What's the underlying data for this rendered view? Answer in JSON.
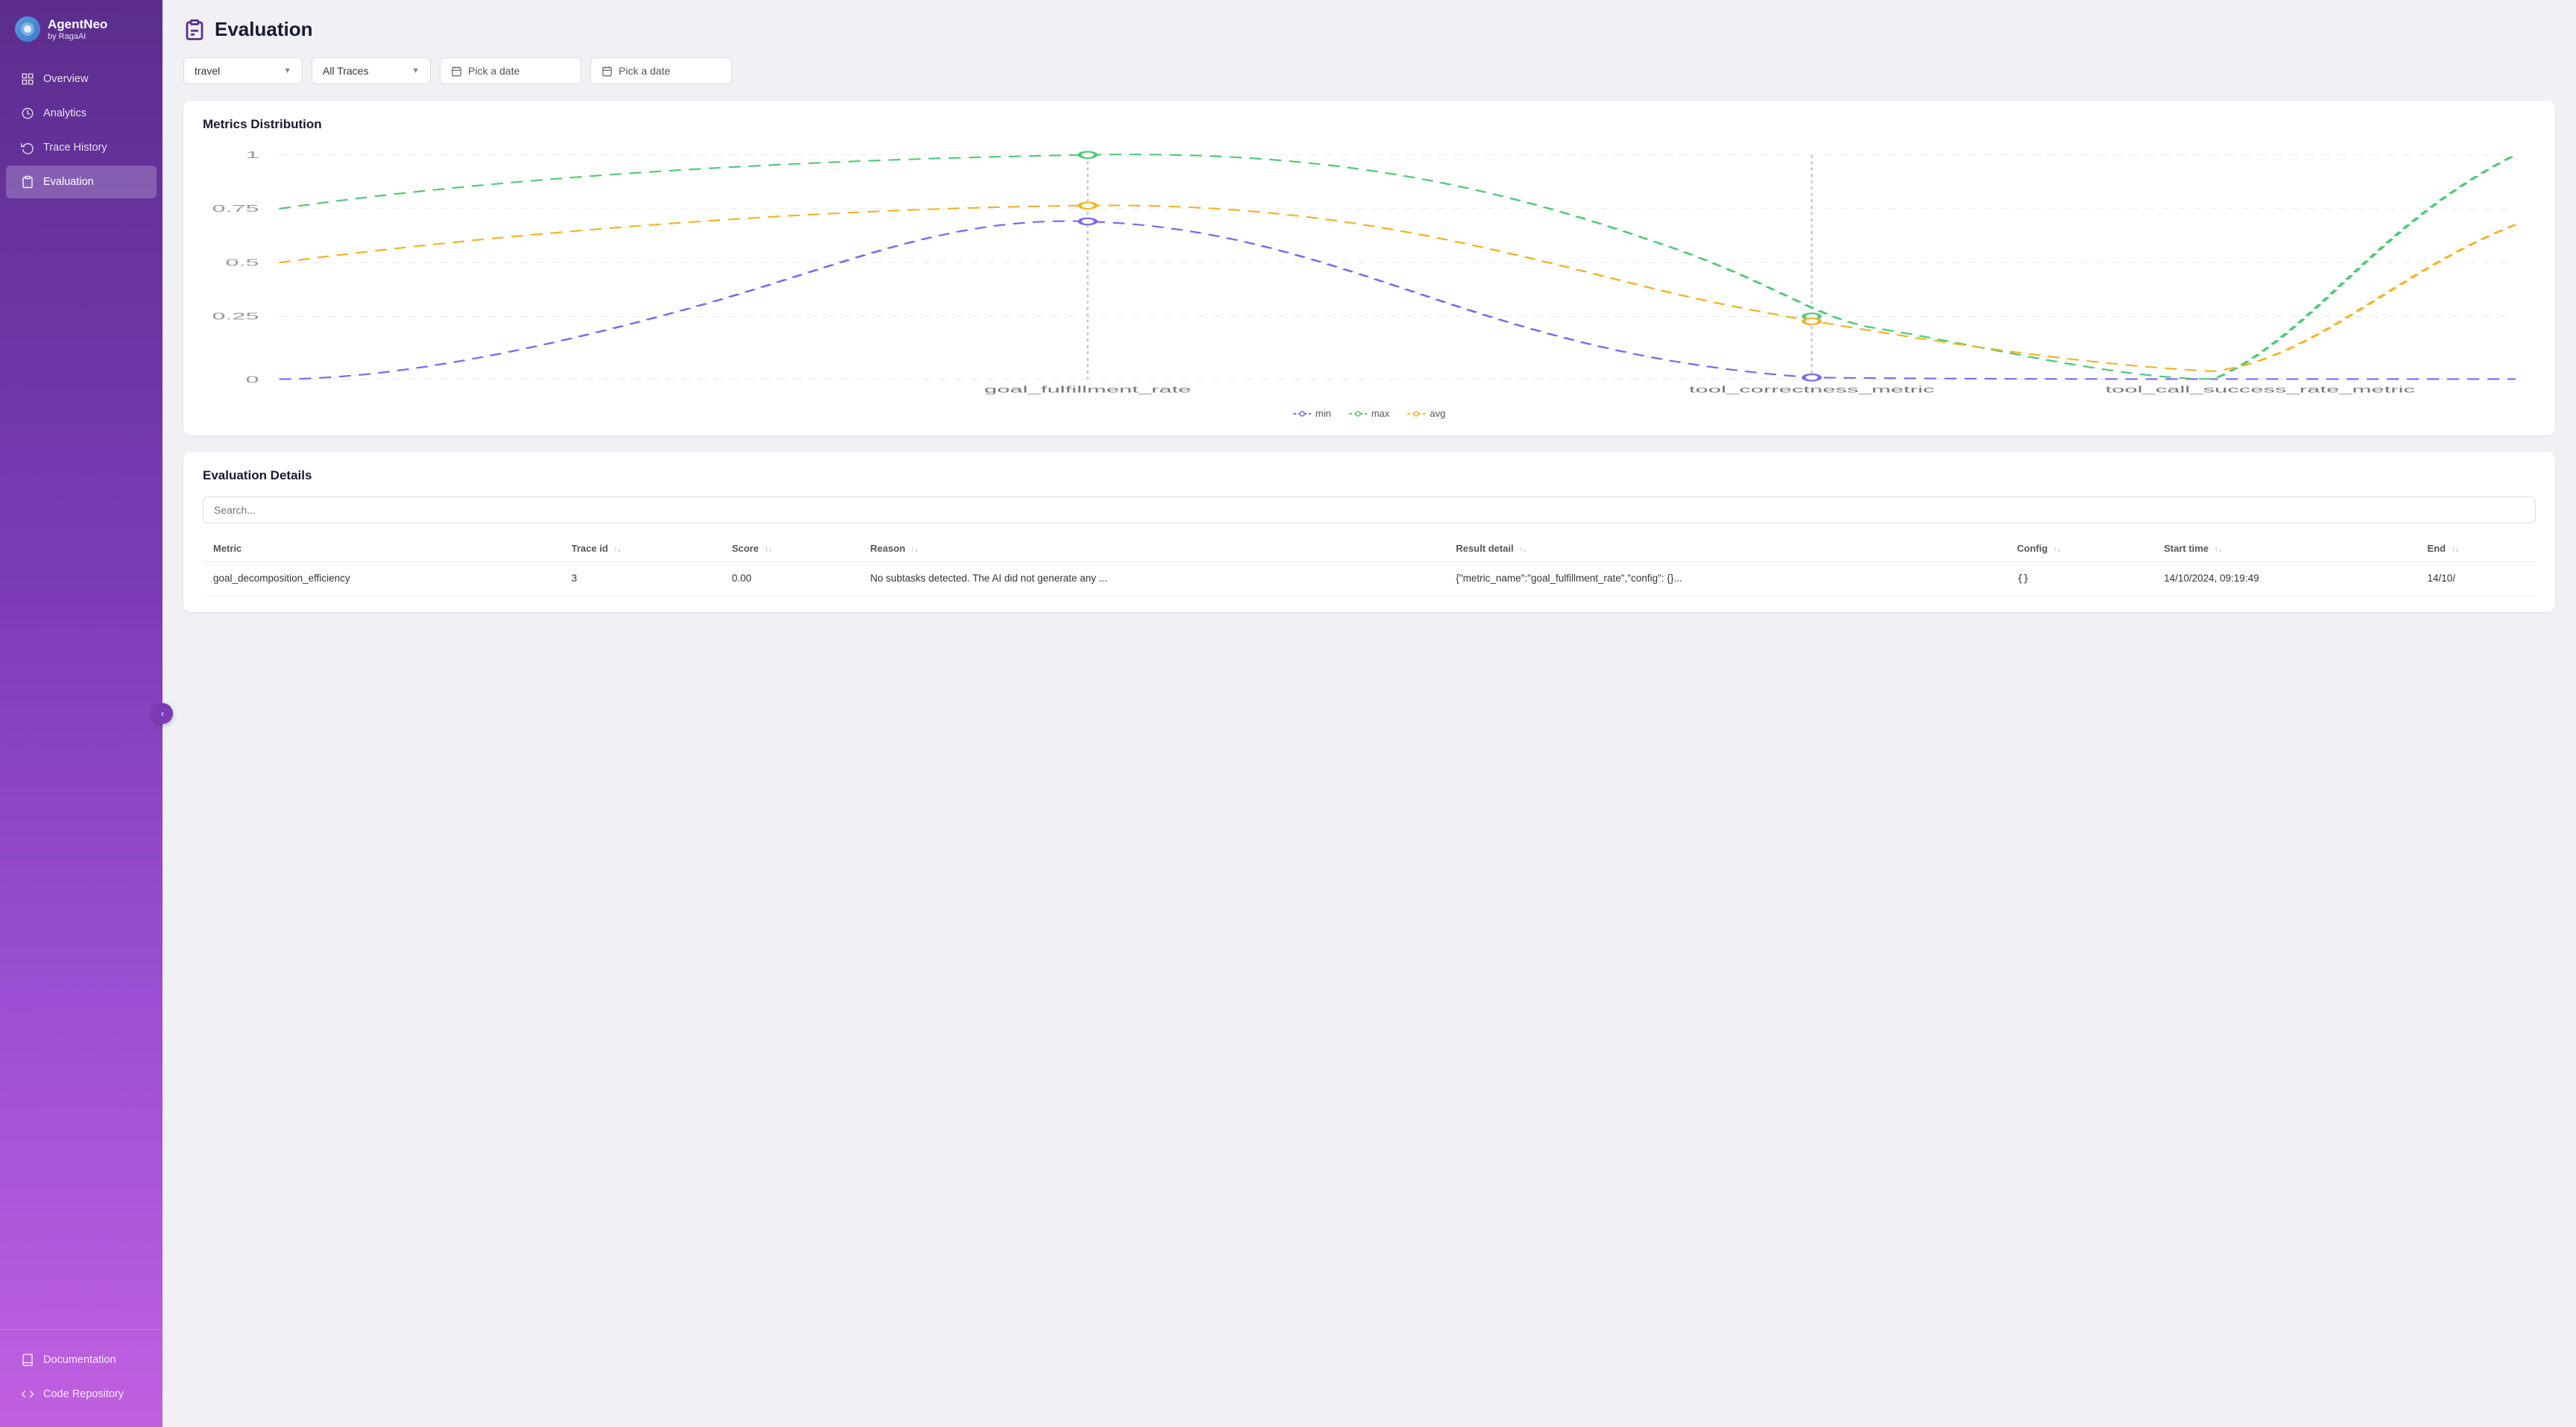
{
  "app": {
    "brand": "AgentNeo",
    "sub": "by RagaAI"
  },
  "sidebar": {
    "collapse_label": "‹",
    "items": [
      {
        "id": "overview",
        "label": "Overview",
        "icon": "grid",
        "active": false
      },
      {
        "id": "analytics",
        "label": "Analytics",
        "icon": "clock-circle",
        "active": false
      },
      {
        "id": "trace-history",
        "label": "Trace History",
        "icon": "history",
        "active": false
      },
      {
        "id": "evaluation",
        "label": "Evaluation",
        "icon": "clipboard",
        "active": true
      }
    ],
    "bottom_items": [
      {
        "id": "documentation",
        "label": "Documentation",
        "icon": "book"
      },
      {
        "id": "code-repository",
        "label": "Code Repository",
        "icon": "code"
      }
    ]
  },
  "page": {
    "title": "Evaluation",
    "icon": "clipboard"
  },
  "filters": {
    "project": {
      "value": "travel",
      "placeholder": "travel"
    },
    "traces": {
      "value": "All Traces",
      "placeholder": "All Traces"
    },
    "date_from": {
      "placeholder": "Pick a date"
    },
    "date_to": {
      "placeholder": "Pick a date"
    }
  },
  "metrics_chart": {
    "title": "Metrics Distribution",
    "x_labels": [
      "goal_fulfillment_rate",
      "tool_correctness_metric",
      "tool_call_success_rate_metric"
    ],
    "y_labels": [
      "0",
      "0.25",
      "0.5",
      "0.75",
      "1"
    ],
    "legend": [
      {
        "id": "min",
        "label": "min",
        "color": "#7b68ee",
        "dash": true
      },
      {
        "id": "max",
        "label": "max",
        "color": "#52c878",
        "dash": true
      },
      {
        "id": "avg",
        "label": "avg",
        "color": "#f0b429",
        "dash": true
      }
    ]
  },
  "evaluation_details": {
    "title": "Evaluation Details",
    "search_placeholder": "Search...",
    "columns": [
      {
        "id": "metric",
        "label": "Metric"
      },
      {
        "id": "trace_id",
        "label": "Trace id"
      },
      {
        "id": "score",
        "label": "Score"
      },
      {
        "id": "reason",
        "label": "Reason"
      },
      {
        "id": "result_detail",
        "label": "Result detail"
      },
      {
        "id": "config",
        "label": "Config"
      },
      {
        "id": "start_time",
        "label": "Start time"
      },
      {
        "id": "end_time",
        "label": "End"
      }
    ],
    "rows": [
      {
        "metric": "goal_decomposition_efficiency",
        "trace_id": "3",
        "score": "0.00",
        "reason": "No subtasks detected. The AI did not generate any ...",
        "result_detail": "{\"metric_name\":\"goal_fulfillment_rate\",\"config\": {}...",
        "config": "{}",
        "start_time": "14/10/2024, 09:19:49",
        "end_time": "14/10/"
      }
    ]
  }
}
